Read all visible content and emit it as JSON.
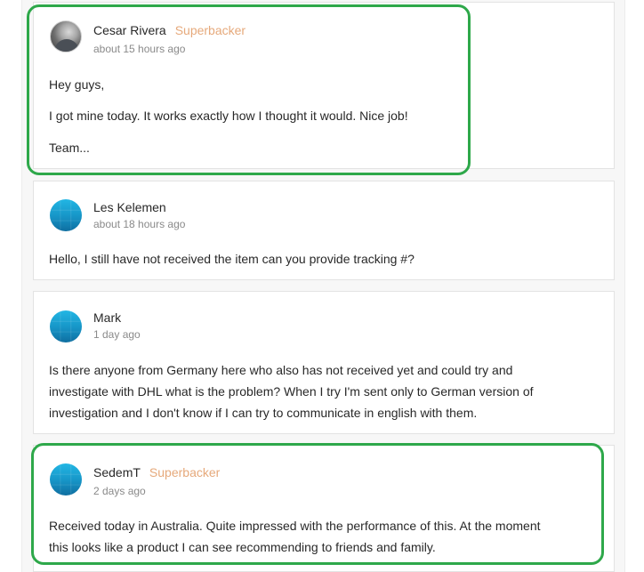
{
  "comments": [
    {
      "author": "Cesar Rivera",
      "badge": "Superbacker",
      "time": "about 15 hours ago",
      "avatar_icon": "user-photo-avatar",
      "lines": [
        "Hey guys,",
        "I got mine today. It works exactly how I thought it would. Nice job!",
        "Team..."
      ]
    },
    {
      "author": "Les Kelemen",
      "badge": "",
      "time": "about 18 hours ago",
      "avatar_icon": "globe-avatar",
      "lines": [
        "Hello, I still have not received the item can you provide tracking #?"
      ]
    },
    {
      "author": "Mark",
      "badge": "",
      "time": "1 day ago",
      "avatar_icon": "globe-avatar",
      "lines": [
        "Is there anyone from Germany here who also has not received yet and could try and",
        "investigate with DHL what is the problem? When I try I'm sent only to German version of",
        "investigation and I don't know if I can try to communicate in english with them."
      ]
    },
    {
      "author": "SedemT",
      "badge": "Superbacker",
      "time": "2 days ago",
      "avatar_icon": "globe-avatar",
      "lines": [
        "Received today in Australia. Quite impressed with the performance of this. At the moment",
        "this looks like a product I can see recommending to friends and family."
      ]
    }
  ],
  "colors": {
    "badge": "#e6a97b",
    "highlight": "#2ea84a",
    "card_border": "#e3e3e3"
  }
}
